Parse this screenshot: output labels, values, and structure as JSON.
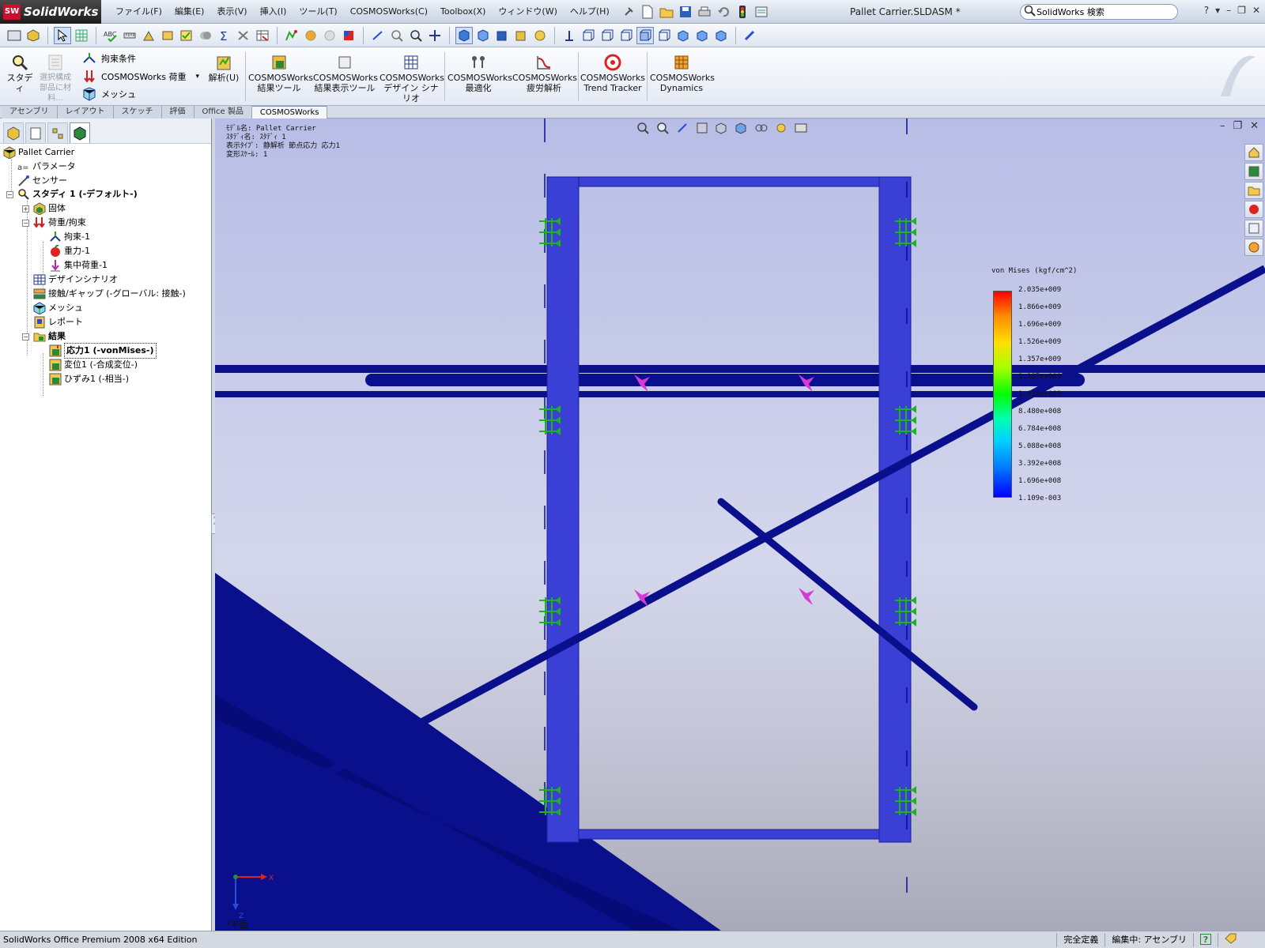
{
  "app": {
    "name": "SolidWorks",
    "logo_mark": "SW",
    "document_title": "Pallet Carrier.SLDASM *"
  },
  "menu": {
    "items": [
      "ファイル(F)",
      "編集(E)",
      "表示(V)",
      "挿入(I)",
      "ツール(T)",
      "COSMOSWorks(C)",
      "Toolbox(X)",
      "ウィンドウ(W)",
      "ヘルプ(H)"
    ]
  },
  "search": {
    "value": "SolidWorks 検索",
    "icon": "search-icon"
  },
  "window_controls": [
    "?",
    "▾",
    "–",
    "❐",
    "✕"
  ],
  "command_manager": {
    "study_label": "スタディ",
    "select_material_label": "選択構成部品に材料...",
    "restraint_label": "拘束条件",
    "load_label": "COSMOSWorks 荷重",
    "mesh_label": "メッシュ",
    "analyze_label": "解析(U)",
    "result_tools_label": "COSMOSWorks 結果ツール",
    "result_display_label": "COSMOSWorks 結果表示ツール",
    "design_scenario_label": "COSMOSWorks デザイン シナリオ",
    "optimize_label": "COSMOSWorks 最適化",
    "fatigue_label": "COSMOSWorks 疲労解析",
    "trend_tracker_label": "COSMOSWorks Trend Tracker",
    "dynamics_label": "COSMOSWorks Dynamics"
  },
  "tabs": [
    "アセンブリ",
    "レイアウト",
    "スケッチ",
    "評価",
    "Office 製品",
    "COSMOSWorks"
  ],
  "active_tab": "COSMOSWorks",
  "tree": {
    "root": "Pallet Carrier",
    "parameters": "パラメータ",
    "sensor": "センサー",
    "study": "スタディ 1 (-デフォルト-)",
    "solid": "固体",
    "loads": "荷重/拘束",
    "restraint1": "拘束-1",
    "gravity1": "重力-1",
    "force1": "集中荷重-1",
    "design_scenario": "デザインシナリオ",
    "contact": "接触/ギャップ (-グローバル: 接触-)",
    "mesh": "メッシュ",
    "report": "レポート",
    "results": "結果",
    "stress1": "応力1 (-vonMises-)",
    "displacement1": "変位1 (-合成変位-)",
    "strain1": "ひずみ1 (-相当-)"
  },
  "viewport": {
    "model_name_line": "ﾓﾃﾞﾙ名: Pallet Carrier",
    "study_name_line": "ｽﾀﾃﾞｨ名: ｽﾀﾃﾞｨ 1",
    "plot_type_line": "表示ﾀｲﾌﾟ: 静解析 節点応力 応力1",
    "deform_scale_line": "変形ｽｹｰﾙ: 1",
    "view_label": "*平面",
    "triad_x": "X",
    "triad_z": "Z"
  },
  "legend": {
    "title": "von Mises (kgf/cm^2)",
    "values": [
      "2.035e+009",
      "1.866e+009",
      "1.696e+009",
      "1.526e+009",
      "1.357e+009",
      "1.187e+009",
      "1.018e+009",
      "8.480e+008",
      "6.784e+008",
      "5.088e+008",
      "3.392e+008",
      "1.696e+008",
      "1.109e-003"
    ]
  },
  "status": {
    "edition": "SolidWorks Office Premium 2008 x64 Edition",
    "definition": "完全定義",
    "editing": "編集中: アセンブリ",
    "help": "?"
  },
  "colors": {
    "frame_blue": "#3a3fd6",
    "dark_blue": "#0a0f8c",
    "restraint_green": "#1db31d",
    "load_magenta": "#d43ad4"
  }
}
